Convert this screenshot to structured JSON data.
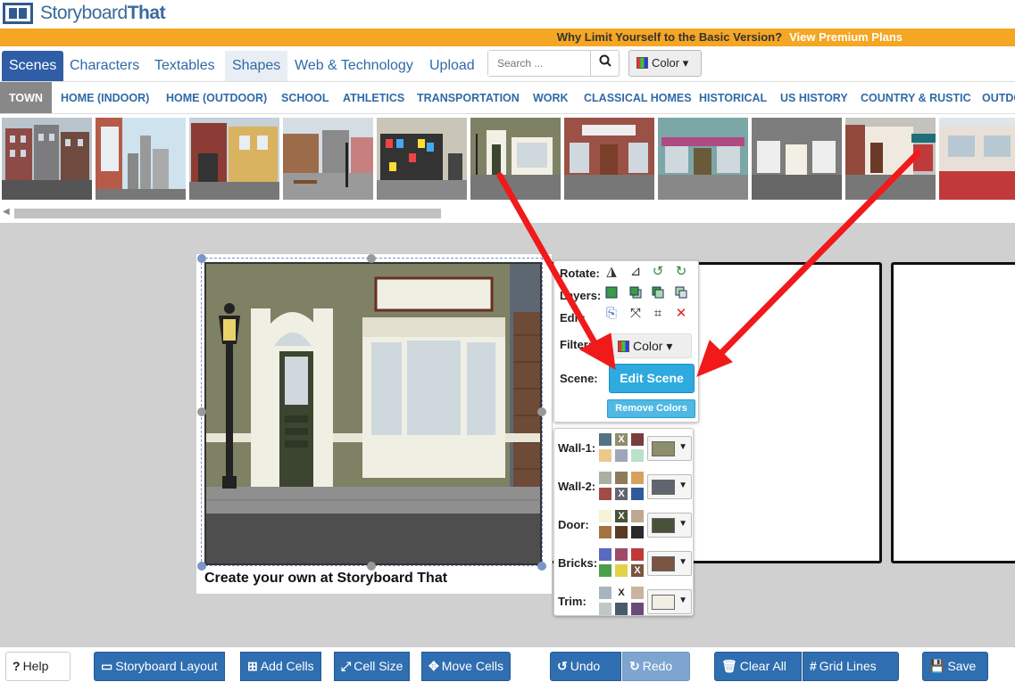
{
  "brand": {
    "name_a": "Storyboard",
    "name_b": "That"
  },
  "promo": {
    "text": "Why Limit Yourself to the Basic Version?",
    "link": "View Premium Plans"
  },
  "tabs": [
    {
      "label": "Scenes"
    },
    {
      "label": "Characters"
    },
    {
      "label": "Textables"
    },
    {
      "label": "Shapes"
    },
    {
      "label": "Web & Technology"
    },
    {
      "label": "Upload"
    }
  ],
  "search": {
    "placeholder": "Search ..."
  },
  "color_button": {
    "label": "Color"
  },
  "categories": [
    {
      "label": "TOWN"
    },
    {
      "label": "HOME (INDOOR)"
    },
    {
      "label": "HOME (OUTDOOR)"
    },
    {
      "label": "SCHOOL"
    },
    {
      "label": "ATHLETICS"
    },
    {
      "label": "TRANSPORTATION"
    },
    {
      "label": "WORK"
    },
    {
      "label": "CLASSICAL HOMES"
    },
    {
      "label": "HISTORICAL"
    },
    {
      "label": "US HISTORY"
    },
    {
      "label": "COUNTRY & RUSTIC"
    },
    {
      "label": "OUTDO"
    }
  ],
  "cell": {
    "caption": "Create your own at Storyboard That"
  },
  "panel": {
    "rotate": "Rotate:",
    "layers": "Layers:",
    "edit": "Edit:",
    "filter": "Filter:",
    "filter_color": "Color",
    "scene": "Scene:",
    "edit_scene": "Edit Scene",
    "remove_colors": "Remove Colors"
  },
  "colors": {
    "wall1": {
      "label": "Wall-1:",
      "current": "#8c8e6c"
    },
    "wall2": {
      "label": "Wall-2:",
      "current": "#5f6670"
    },
    "door": {
      "label": "Door:",
      "current": "#4a5139"
    },
    "bricks": {
      "label": "Bricks:",
      "current": "#7a5440"
    },
    "trim": {
      "label": "Trim:",
      "current": "#efefe4"
    },
    "x": "X"
  },
  "toolbar": {
    "help": "Help",
    "layout": "Storyboard Layout",
    "add": "Add Cells",
    "size": "Cell Size",
    "move": "Move Cells",
    "undo": "Undo",
    "redo": "Redo",
    "clear": "Clear All",
    "grid": "Grid Lines",
    "save": "Save"
  },
  "accent": "#2f6eb0",
  "arrow_color": "#f01a1a"
}
